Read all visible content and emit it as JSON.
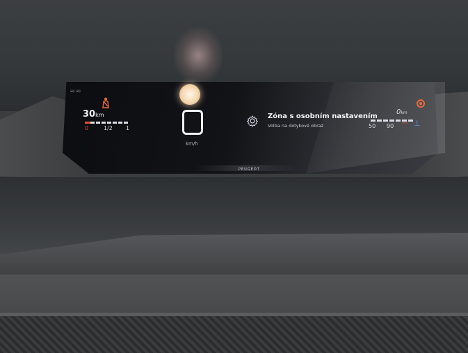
{
  "cluster": {
    "range_value": "30",
    "range_unit": "km",
    "fuel_labels": [
      "0",
      "1/2",
      "1"
    ],
    "speed_unit": "km/h",
    "zone_title": "Zóna s osobním nastavením",
    "zone_subtitle": "Volba na dotykové obraz",
    "odo_value": "0",
    "odo_unit": "km",
    "speed_limits": [
      "50",
      "90"
    ],
    "brand": "PEUGEOT"
  },
  "colors": {
    "warning": "#e24a3a",
    "text": "#d8dde6",
    "coolant": "#5aa0e6"
  },
  "icons": [
    "seatbelt-icon",
    "settings-gear-icon",
    "brake-warning-icon",
    "coolant-temp-icon",
    "eco-wave-icon"
  ]
}
